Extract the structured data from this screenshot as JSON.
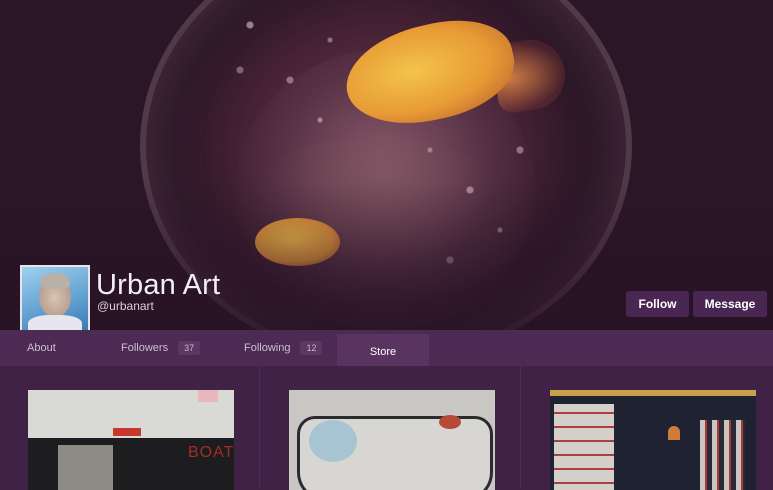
{
  "profile": {
    "name": "Urban Art",
    "handle": "@urbanart"
  },
  "actions": {
    "follow_label": "Follow",
    "message_label": "Message"
  },
  "tabs": [
    {
      "label": "About"
    },
    {
      "label": "Followers",
      "count": "37"
    },
    {
      "label": "Following",
      "count": "12"
    },
    {
      "label": "Store",
      "active": true
    }
  ],
  "artwork": {
    "art1_text": "BOAT"
  },
  "colors": {
    "background": "#3f2245",
    "tabbar": "#4d2a53",
    "active_tab": "#5a3461",
    "button": "#4a2752"
  }
}
